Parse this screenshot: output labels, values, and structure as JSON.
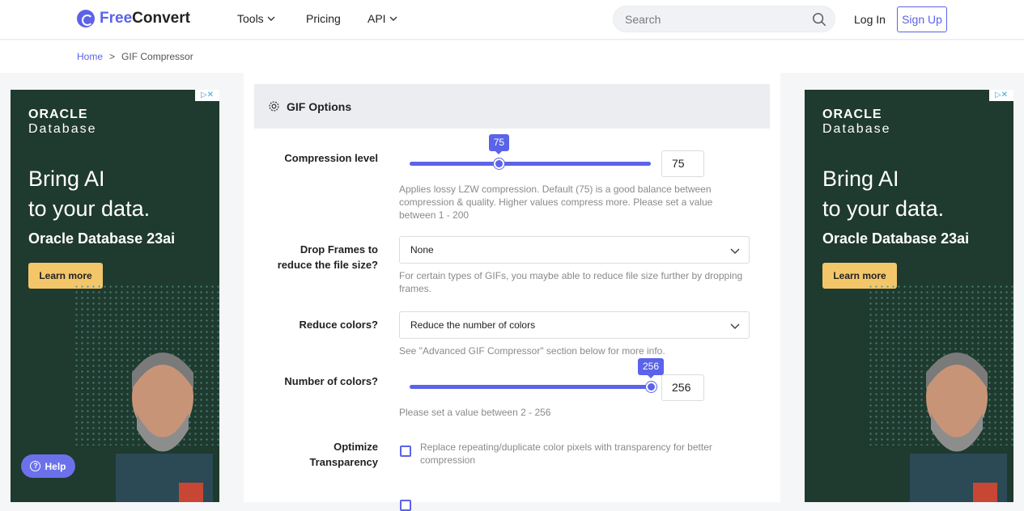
{
  "header": {
    "logo_free": "Free",
    "logo_convert": "Convert",
    "nav": [
      {
        "label": "Tools"
      },
      {
        "label": "Pricing"
      },
      {
        "label": "API"
      }
    ],
    "search_placeholder": "Search",
    "login_label": "Log In",
    "signup_label": "Sign Up"
  },
  "breadcrumb": {
    "home": "Home",
    "separator": ">",
    "current": "GIF Compressor"
  },
  "ad": {
    "adchoices": "▷✕",
    "brand_line1": "ORACLE",
    "brand_line2": "Database",
    "headline_line1": "Bring AI",
    "headline_line2": "to your data.",
    "product": "Oracle Database 23ai",
    "cta": "Learn more"
  },
  "options": {
    "title": "GIF Options",
    "compression": {
      "label": "Compression level",
      "value": "75",
      "bubble": "75",
      "fraction": 0.37,
      "help": "Applies lossy LZW compression. Default (75) is a good balance between compression & quality. Higher values compress more. Please set a value between 1 - 200"
    },
    "drop_frames": {
      "label_line1": "Drop Frames to",
      "label_line2": "reduce the file size?",
      "selected": "None",
      "help": "For certain types of GIFs, you maybe able to reduce file size further by dropping frames."
    },
    "reduce_colors": {
      "label": "Reduce colors?",
      "selected": "Reduce the number of colors",
      "help": "See \"Advanced GIF Compressor\" section below for more info."
    },
    "num_colors": {
      "label": "Number of colors?",
      "value": "256",
      "bubble": "256",
      "fraction": 1.0,
      "help": "Please set a value between 2 - 256"
    },
    "transparency": {
      "label_line1": "Optimize",
      "label_line2": "Transparency",
      "text": "Replace repeating/duplicate color pixels with transparency for better compression"
    }
  },
  "help_button": "Help",
  "colors": {
    "accent": "#5b63e8",
    "ad_bg": "#1f3a2e",
    "ad_cta": "#f3c66a"
  }
}
